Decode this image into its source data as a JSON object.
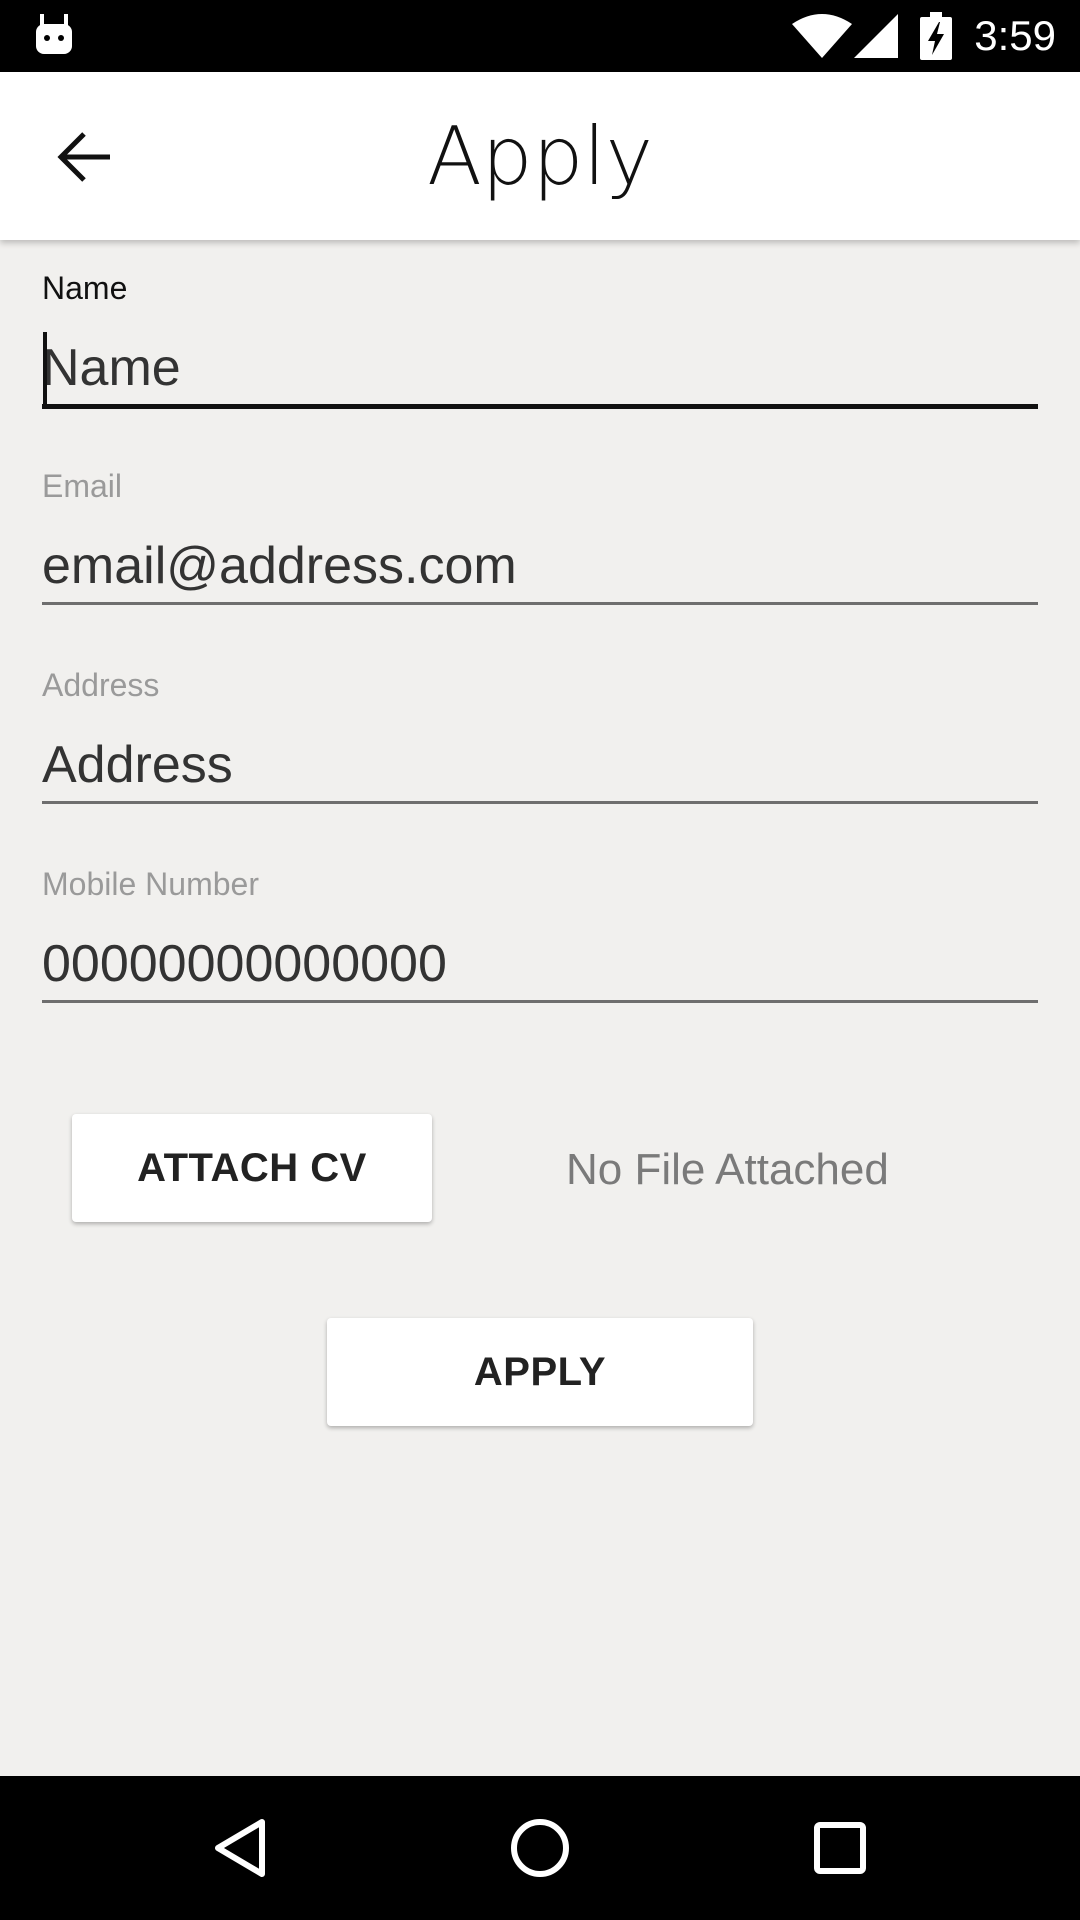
{
  "status_bar": {
    "time": "3:59",
    "icons": [
      "android-icon",
      "wifi-icon",
      "cell-signal-icon",
      "battery-charging-icon"
    ]
  },
  "app_bar": {
    "title": "Apply",
    "back_icon": "arrow-back-icon"
  },
  "form": {
    "name": {
      "label": "Name",
      "value": "",
      "placeholder": "Name"
    },
    "email": {
      "label": "Email",
      "value": "",
      "placeholder": "email@address.com"
    },
    "address": {
      "label": "Address",
      "value": "",
      "placeholder": "Address"
    },
    "mobile": {
      "label": "Mobile Number",
      "value": "",
      "placeholder": "00000000000000"
    }
  },
  "attachment": {
    "button_label": "ATTACH CV",
    "status_text": "No File Attached"
  },
  "apply_button_label": "APPLY",
  "nav_bar": {
    "icons": [
      "nav-back-icon",
      "nav-home-icon",
      "nav-recents-icon"
    ]
  },
  "colors": {
    "background": "#f1f0ee",
    "app_bar": "#ffffff",
    "system_bars": "#000000",
    "label_inactive": "#9a9a9a",
    "label_active": "#111111"
  }
}
